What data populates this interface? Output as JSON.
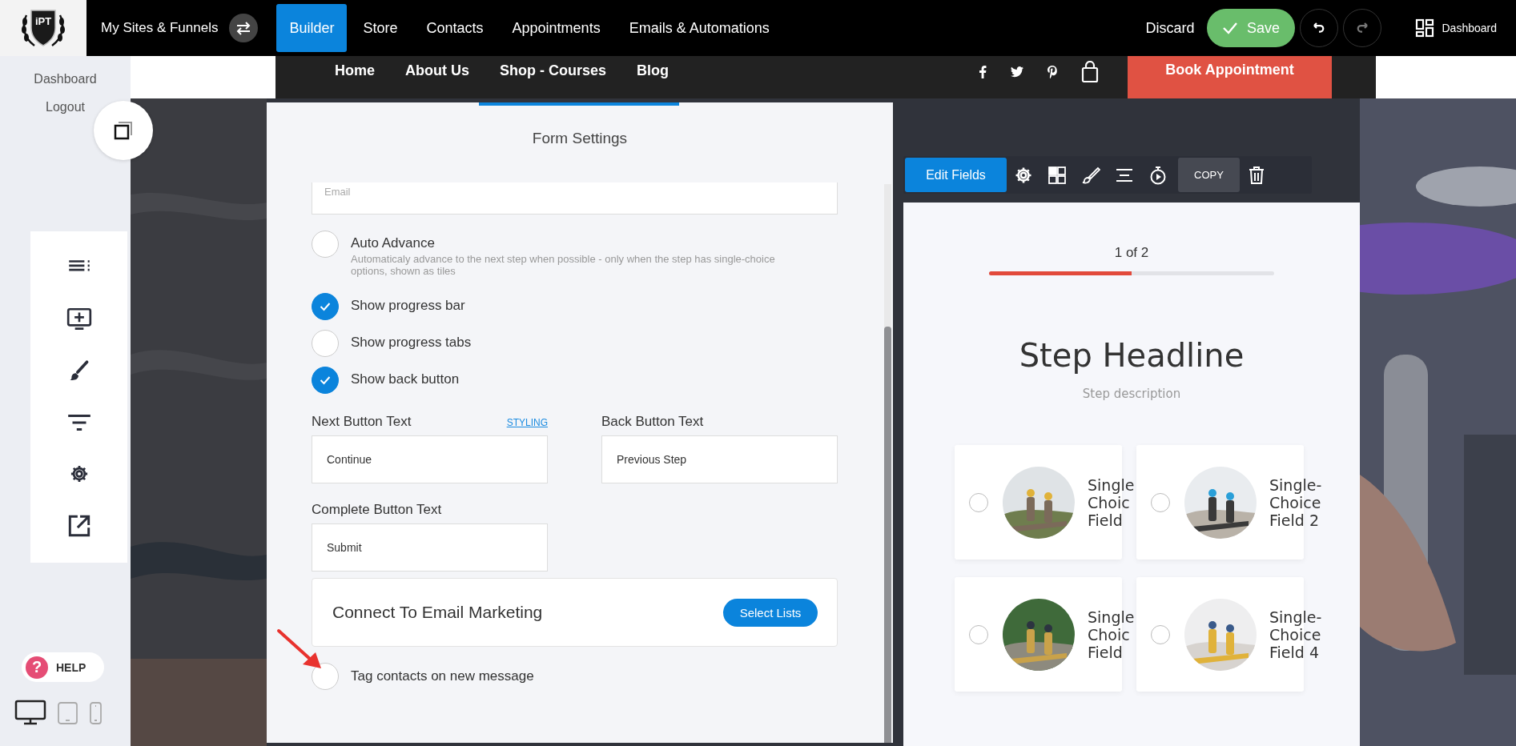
{
  "topbar": {
    "logo_text": "iPT",
    "site_menu": "My Sites & Funnels",
    "nav": [
      {
        "label": "Builder",
        "selected": true
      },
      {
        "label": "Store",
        "selected": false
      },
      {
        "label": "Contacts",
        "selected": false
      },
      {
        "label": "Appointments",
        "selected": false
      },
      {
        "label": "Emails & Automations",
        "selected": false
      }
    ],
    "discard": "Discard",
    "save": "Save",
    "history": [
      {
        "kind": "undo",
        "disabled": false
      },
      {
        "kind": "redo",
        "disabled": true
      }
    ],
    "dashboard": "Dashboard"
  },
  "sidebar": {
    "links": [
      "Dashboard",
      "Logout"
    ],
    "help_glyph": "?",
    "help": "HELP",
    "devices": [
      {
        "kind": "desktop",
        "selected": true
      },
      {
        "kind": "tablet",
        "selected": false
      },
      {
        "kind": "phone",
        "selected": false
      }
    ]
  },
  "site_nav": {
    "links": [
      "Home",
      "About Us",
      "Shop - Courses",
      "Blog"
    ],
    "cta": "Book Appointment"
  },
  "form_settings": {
    "title": "Form Settings",
    "email_field": {
      "placeholder": "Email"
    },
    "options": [
      {
        "label": "Auto Advance",
        "description": "Automaticaly advance to the next step when possible - only when the step has single-choice options, shown as tiles",
        "checked": false
      },
      {
        "label": "Show progress bar",
        "checked": true
      },
      {
        "label": "Show progress tabs",
        "checked": false
      },
      {
        "label": "Show back button",
        "checked": true
      }
    ],
    "button_texts": [
      {
        "label": "Next Button Text",
        "link": "STYLING",
        "value": "Continue"
      },
      {
        "label": "Back Button Text",
        "value": "Previous Step"
      },
      {
        "label": "Complete Button Text",
        "value": "Submit"
      }
    ],
    "email_marketing": {
      "title": "Connect To Email Marketing",
      "button": "Select Lists"
    },
    "tag_option": {
      "label": "Tag contacts on new message",
      "checked": false
    }
  },
  "preview": {
    "toolbar": {
      "edit": "Edit Fields",
      "copy": "COPY"
    },
    "step_counter": "1 of 2",
    "progress": {
      "level": 0.5
    },
    "headline": "Step Headline",
    "description": "Step description",
    "choices": [
      {
        "lines": [
          "Single",
          "Choic",
          "Field"
        ],
        "selected": false
      },
      {
        "lines": [
          "Single-",
          "Choice",
          "Field 2"
        ],
        "selected": false
      },
      {
        "lines": [
          "Single",
          "Choic",
          "Field"
        ],
        "selected": false
      },
      {
        "lines": [
          "Single-",
          "Choice",
          "Field 4"
        ],
        "selected": false
      }
    ]
  }
}
